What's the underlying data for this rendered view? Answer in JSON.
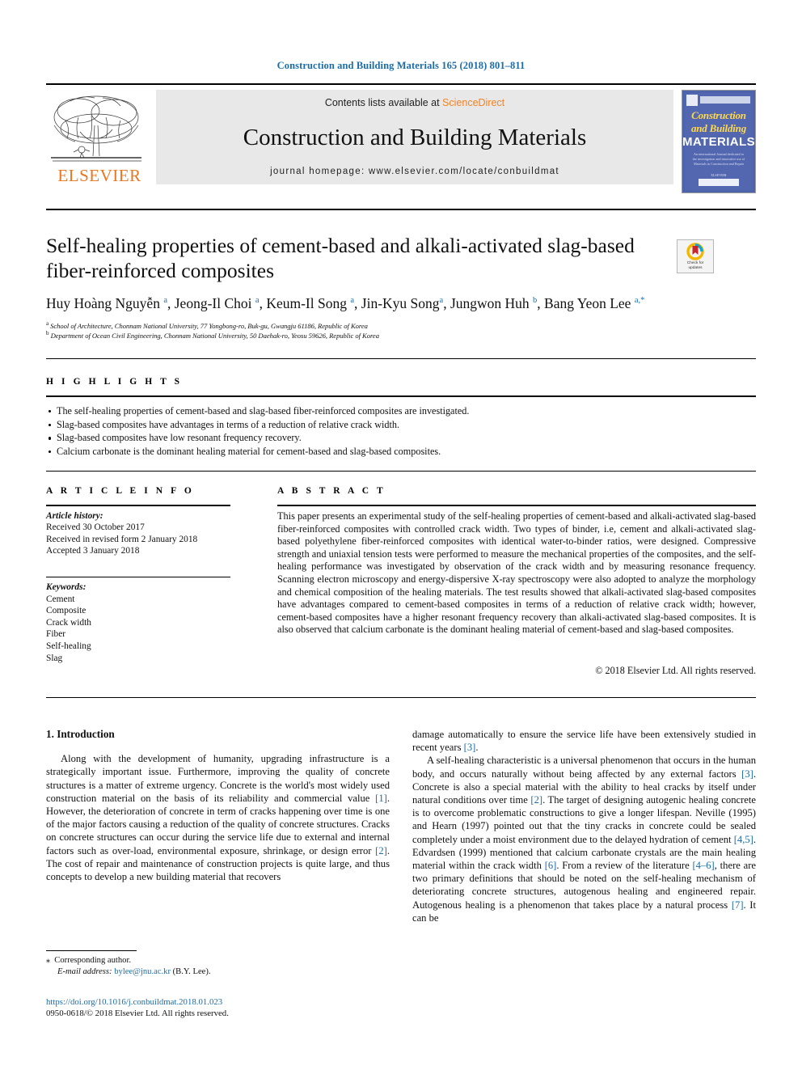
{
  "running_head": "Construction and Building Materials 165 (2018) 801–811",
  "masthead": {
    "publisher_logo_label": "ELSEVIER",
    "contents_prefix": "Contents lists available at ",
    "contents_link": "ScienceDirect",
    "journal_name": "Construction and Building Materials",
    "homepage_line": "journal homepage: www.elsevier.com/locate/conbuildmat",
    "cover": {
      "line1": "Construction",
      "line2": "and Building",
      "line3": "MATERIALS",
      "blurb": "An international Journal dedicated to the investigation and innovative use of Materials in Construction and Repair",
      "footer_label": "ELSEVIER"
    }
  },
  "article": {
    "title": "Self-healing properties of cement-based and alkali-activated slag-based fiber-reinforced composites",
    "crossmark": {
      "line1": "Check for",
      "line2": "updates"
    },
    "authors_html": "Huy Hoàng Nguyễn <sup>a</sup>, Jeong-Il Choi <sup>a</sup>, Keum-Il Song <sup>a</sup>, Jin-Kyu Song<sup>a</sup>, Jungwon Huh <sup>b</sup>, Bang Yeon Lee <sup>a,</sup><sup>*</sup>",
    "affiliation_a": "School of Architecture, Chonnam National University, 77 Yongbong-ro, Buk-gu, Gwangju 61186, Republic of Korea",
    "affiliation_b": "Department of Ocean Civil Engineering, Chonnam National University, 50 Daehak-ro, Yeosu 59626, Republic of Korea"
  },
  "highlights": {
    "heading": "H I G H L I G H T S",
    "items": [
      "The self-healing properties of cement-based and slag-based fiber-reinforced composites are investigated.",
      "Slag-based composites have advantages in terms of a reduction of relative crack width.",
      "Slag-based composites have low resonant frequency recovery.",
      "Calcium carbonate is the dominant healing material for cement-based and slag-based composites."
    ]
  },
  "article_info": {
    "heading": "A R T I C L E   I N F O",
    "history_label": "Article history:",
    "history": [
      "Received 30 October 2017",
      "Received in revised form 2 January 2018",
      "Accepted 3 January 2018"
    ],
    "keywords_label": "Keywords:",
    "keywords": [
      "Cement",
      "Composite",
      "Crack width",
      "Fiber",
      "Self-healing",
      "Slag"
    ]
  },
  "abstract": {
    "heading": "A B S T R A C T",
    "text": "This paper presents an experimental study of the self-healing properties of cement-based and alkali-activated slag-based fiber-reinforced composites with controlled crack width. Two types of binder, i.e, cement and alkali-activated slag-based polyethylene fiber-reinforced composites with identical water-to-binder ratios, were designed. Compressive strength and uniaxial tension tests were performed to measure the mechanical properties of the composites, and the self-healing performance was investigated by observation of the crack width and by measuring resonance frequency. Scanning electron microscopy and energy-dispersive X-ray spectroscopy were also adopted to analyze the morphology and chemical composition of the healing materials. The test results showed that alkali-activated slag-based composites have advantages compared to cement-based composites in terms of a reduction of relative crack width; however, cement-based composites have a higher resonant frequency recovery than alkali-activated slag-based composites. It is also observed that calcium carbonate is the dominant healing material of cement-based and slag-based composites.",
    "copyright": "© 2018 Elsevier Ltd. All rights reserved."
  },
  "body": {
    "section_heading": "1. Introduction",
    "left_paragraph_1_a": "Along with the development of humanity, upgrading infrastructure is a strategically important issue. Furthermore, improving the quality of concrete structures is a matter of extreme urgency. Concrete is the world's most widely used construction material on the basis of its reliability and commercial value ",
    "left_ref_1": "[1]",
    "left_paragraph_1_b": ". However, the deterioration of concrete in term of cracks happening over time is one of the major factors causing a reduction of the quality of concrete structures. Cracks on concrete structures can occur during the service life due to external and internal factors such as over-load, environmental exposure, shrinkage, or design error ",
    "left_ref_2": "[2]",
    "left_paragraph_1_c": ". The cost of repair and maintenance of construction projects is quite large, and thus concepts to develop a new building material that recovers",
    "right_paragraph_1_a": "damage automatically to ensure the service life have been extensively studied in recent years ",
    "right_ref_3": "[3]",
    "right_paragraph_1_b": ".",
    "right_paragraph_2_a": "A self-healing characteristic is a universal phenomenon that occurs in the human body, and occurs naturally without being affected by any external factors ",
    "right_ref_3b": "[3]",
    "right_paragraph_2_b": ". Concrete is also a special material with the ability to heal cracks by itself under natural conditions over time ",
    "right_ref_2": "[2]",
    "right_paragraph_2_c": ". The target of designing autogenic healing concrete is to overcome problematic constructions to give a longer lifespan. Neville (1995) and Hearn (1997) pointed out that the tiny cracks in concrete could be sealed completely under a moist environment due to the delayed hydration of cement ",
    "right_ref_45": "[4,5]",
    "right_paragraph_2_d": ". Edvardsen (1999) mentioned that calcium carbonate crystals are the main healing material within the crack width ",
    "right_ref_6": "[6]",
    "right_paragraph_2_e": ". From a review of the literature ",
    "right_ref_46": "[4–6]",
    "right_paragraph_2_f": ", there are two primary definitions that should be noted on the self-healing mechanism of deteriorating concrete structures, autogenous healing and engineered repair. Autogenous healing is a phenomenon that takes place by a natural process ",
    "right_ref_7": "[7]",
    "right_paragraph_2_g": ". It can be"
  },
  "footer": {
    "corresponding_marker": "⁎",
    "corresponding_author": "Corresponding author.",
    "email_label": "E-mail address:",
    "email": "bylee@jnu.ac.kr",
    "email_person": "(B.Y. Lee).",
    "doi": "https://doi.org/10.1016/j.conbuildmat.2018.01.023",
    "issn_line": "0950-0618/© 2018 Elsevier Ltd. All rights reserved."
  },
  "colors": {
    "link_blue": "#1b6ca8",
    "elsevier_orange": "#e87722",
    "band_gray": "#e8e8e8",
    "cover_blue": "#4d63ab",
    "cover_yellow": "#ffd94a"
  }
}
